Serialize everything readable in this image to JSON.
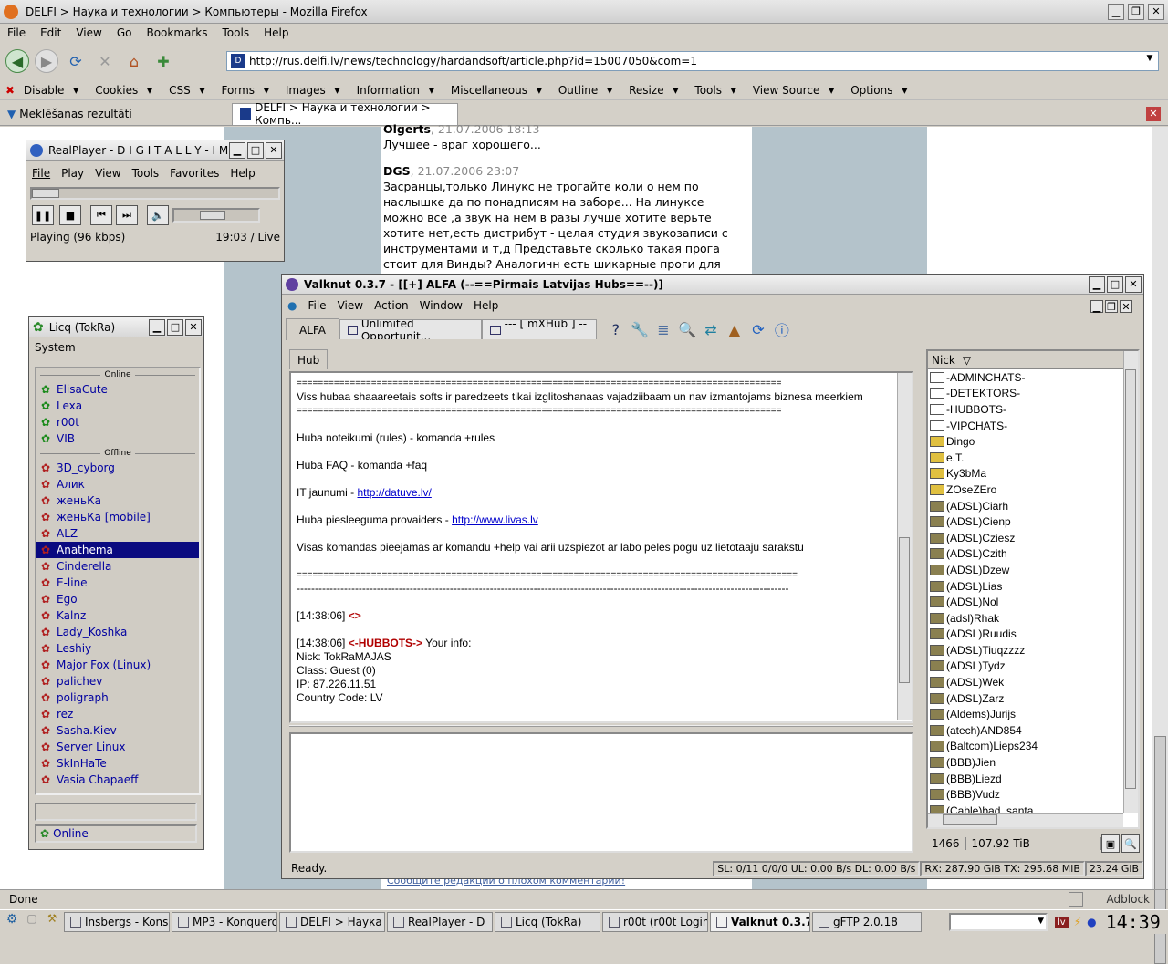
{
  "firefox": {
    "title": "DELFI > Наука и технологии > Компьютеры - Mozilla Firefox",
    "menu": [
      "File",
      "Edit",
      "View",
      "Go",
      "Bookmarks",
      "Tools",
      "Help"
    ],
    "url": "http://rus.delfi.lv/news/technology/hardandsoft/article.php?id=15007050&com=1",
    "webdev": [
      "Disable",
      "Cookies",
      "CSS",
      "Forms",
      "Images",
      "Information",
      "Miscellaneous",
      "Outline",
      "Resize",
      "Tools",
      "View Source",
      "Options"
    ],
    "tabs": [
      "Meklēšanas rezultāti",
      "DELFI > Наука и технологии > Компь..."
    ],
    "status": "Done",
    "adblock": "Adblock"
  },
  "article": {
    "c1_author": "Olgerts",
    "c1_date": ", 21.07.2006 18:13",
    "c1_text": "Лучшее - враг хорошего...",
    "c2_author": "DGS",
    "c2_date": ", 21.07.2006 23:07",
    "c2_lines": [
      "Засранцы,только Линукс не трогайте коли о нем по",
      "наслышке да по понадписям на заборе... На линуксе",
      "можно все ,а звук на нем в разы лучше хотите верьте",
      "хотите нет,есть дистрибут - целая студия звукозаписи с",
      "инструментами и т,д Представьте сколько такая прога",
      "стоит для Винды? Аналогичн есть шикарные проги для"
    ],
    "footer": "Сообщите редакции о плохом комментарии!"
  },
  "realplayer": {
    "title": "RealPlayer - D I G I T A L L Y - I M",
    "menu": [
      "File",
      "Play",
      "View",
      "Tools",
      "Favorites",
      "Help"
    ],
    "status": "Playing (96 kbps)",
    "time": "19:03 / Live"
  },
  "licq": {
    "title": "Licq (TokRa)",
    "menu": "System",
    "online_header": "Online",
    "offline_header": "Offline",
    "online": [
      "ElisaCute",
      "Lexa",
      "r00t",
      "VIB"
    ],
    "offline": [
      "3D_cyborg",
      "Алик",
      "женьКа",
      "женьКа [mobile]",
      "ALZ",
      "Anathema",
      "Cinderella",
      "E-line",
      "Ego",
      "Kalnz",
      "Lady_Koshka",
      "Leshiy",
      "Major Fox (Linux)",
      "palichev",
      "poligraph",
      "rez",
      "Sasha.Kiev",
      "Server Linux",
      "SkInHaTe",
      "Vasia Chapaeff"
    ],
    "selected": "Anathema",
    "status": "Online"
  },
  "valknut": {
    "title": "Valknut 0.3.7 - [[+] ALFA (--==Pirmais Latvijas Hubs==--)]",
    "menu": [
      "File",
      "View",
      "Action",
      "Window",
      "Help"
    ],
    "tabs": [
      "ALFA",
      "Unlimited Opportunit...",
      "--- [ mXHub ] ---"
    ],
    "subtab": "Hub",
    "nick_header": "Nick",
    "chat_lines": [
      {
        "t": "sep",
        "text": "==========================================================================================="
      },
      {
        "t": "txt",
        "text": "Viss hubaa shaaareetais softs ir paredzeets tikai izglitoshanaas vajadziibaam un nav izmantojams biznesa meerkiem"
      },
      {
        "t": "sep",
        "text": "==========================================================================================="
      },
      {
        "t": "blank"
      },
      {
        "t": "txt",
        "text": "Huba noteikumi (rules) - komanda +rules"
      },
      {
        "t": "blank"
      },
      {
        "t": "txt",
        "text": "Huba FAQ - komanda +faq"
      },
      {
        "t": "blank"
      },
      {
        "t": "link",
        "pre": "IT jaunumi - ",
        "link": "http://datuve.lv/"
      },
      {
        "t": "blank"
      },
      {
        "t": "link",
        "pre": "Huba piesleeguma provaiders - ",
        "link": "http://www.livas.lv"
      },
      {
        "t": "blank"
      },
      {
        "t": "txt",
        "text": "Visas komandas pieejamas ar komandu +help  vai arii uzspiezot ar labo peles pogu uz lietotaaju sarakstu"
      },
      {
        "t": "blank"
      },
      {
        "t": "sep",
        "text": "=============================================================================================="
      },
      {
        "t": "txt",
        "text": "---------------------------------------------------------------------------------------------------------------------------------------"
      },
      {
        "t": "blank"
      },
      {
        "t": "msg",
        "ts": "[14:38:06] ",
        "who": "<>",
        "text": ""
      },
      {
        "t": "blank"
      },
      {
        "t": "msg",
        "ts": "[14:38:06] ",
        "who": "<-HUBBOTS->",
        "text": " Your info:"
      },
      {
        "t": "txt",
        "text": "Nick: TokRaMAJAS"
      },
      {
        "t": "txt",
        "text": "Class: Guest (0)"
      },
      {
        "t": "txt",
        "text": "IP: 87.226.11.51"
      },
      {
        "t": "txt",
        "text": "Country Code: LV"
      }
    ],
    "nicks": [
      "-ADMINCHATS-",
      "-DETEKTORS-",
      "-HUBBOTS-",
      "-VIPCHATS-",
      "Dingo",
      "e.T.",
      "Ky3bMa",
      "ZOseZEro",
      "(ADSL)Ciarh",
      "(ADSL)Cienp",
      "(ADSL)Cziesz",
      "(ADSL)Czith",
      "(ADSL)Dzew",
      "(ADSL)Lias",
      "(ADSL)Nol",
      "(adsl)Rhak",
      "(ADSL)Ruudis",
      "(ADSL)Tiuqzzzz",
      "(ADSL)Tydz",
      "(ADSL)Wek",
      "(ADSL)Zarz",
      "(Aldems)Jurijs",
      "(atech)AND854",
      "(Baltcom)Lieps234",
      "(BBB)Jien",
      "(BBB)Liezd",
      "(BBB)Vudz",
      "(Cable)bad_santa"
    ],
    "user_count": "1466",
    "share": "107.92 TiB",
    "status": "Ready.",
    "slots": "SL: 0/11 0/0/0 UL: 0.00 B/s DL: 0.00 B/s",
    "rxtx": "RX: 287.90 GiB TX: 295.68 MiB",
    "total": "23.24 GiB"
  },
  "taskbar": {
    "tasks": [
      "Insbergs - Kons",
      "MP3 - Konquero",
      "DELFI > Наука и",
      "RealPlayer - D",
      "Licq (TokRa)",
      "r00t (r00t Login",
      "Valknut 0.3.7 -",
      "gFTP 2.0.18"
    ],
    "active": "Valknut 0.3.7 -",
    "layout": "lv",
    "clock": "14:39"
  }
}
